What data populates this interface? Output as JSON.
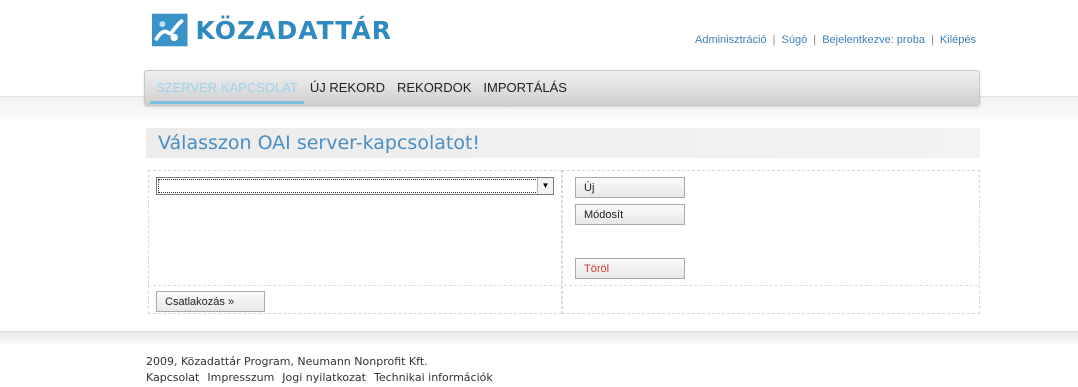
{
  "logo": {
    "text": "KÖZADATTÁR",
    "icon": "kozadattar-logo-icon",
    "color": "#2f8bbf"
  },
  "toplinks": {
    "admin": "Adminisztráció",
    "help": "Súgó",
    "logged_in": "Bejelentkezve: proba",
    "logout": "Kilépés",
    "separator": "|"
  },
  "nav": {
    "items": [
      {
        "label": "SZERVER KAPCSOLAT",
        "active": true
      },
      {
        "label": "ÚJ REKORD",
        "active": false
      },
      {
        "label": "REKORDOK",
        "active": false
      },
      {
        "label": "IMPORTÁLÁS",
        "active": false
      }
    ]
  },
  "page": {
    "title": "Válasszon OAI server-kapcsolatot!"
  },
  "form": {
    "select_value": "",
    "buttons": {
      "new": "Új",
      "modify": "Módosít",
      "delete": "Töröl",
      "connect": "Csatlakozás »"
    }
  },
  "footer": {
    "copyright": "2009, Közadattár Program, Neumann Nonprofit Kft.",
    "links": [
      "Kapcsolat",
      "Impresszum",
      "Jogi nyilatkozat",
      "Technikai információk"
    ]
  },
  "colors": {
    "accent": "#4a8ec2",
    "delete": "#d23a2a",
    "active_tab": "#9bd3ee"
  }
}
